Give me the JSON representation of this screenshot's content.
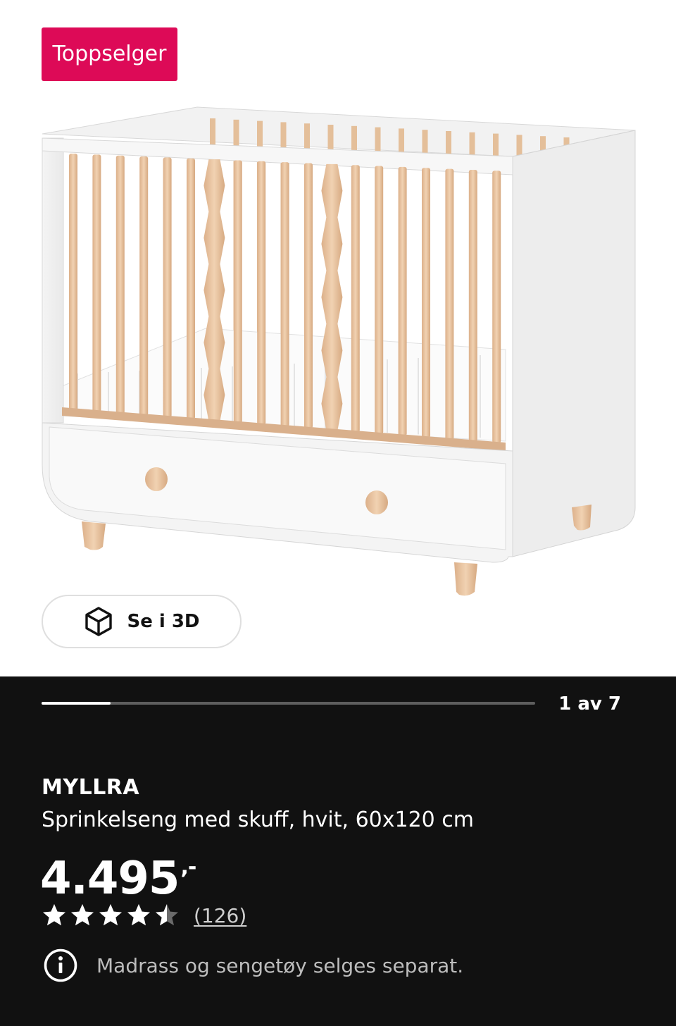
{
  "hero": {
    "badge": "Toppselger",
    "view_3d_label": "Se i 3D",
    "view_3d_icon": "cube-3d-icon",
    "image_subject": "crib"
  },
  "gallery": {
    "current": 1,
    "total": 7,
    "progress": 0.14,
    "pager_text": "1 av 7"
  },
  "product": {
    "name": "MYLLRA",
    "description": "Sprinkelseng med skuff, hvit, 60x120 cm",
    "price_main": "4.495",
    "price_suffix": ",-",
    "rating": 4.5,
    "rating_max": 5,
    "review_count": "(126)",
    "notice": "Madrass og sengetøy selges separat.",
    "notice_icon": "info-icon"
  },
  "colors": {
    "badge_bg": "#dd0a57",
    "panel_bg": "#111111",
    "wood": "#e8c4a0"
  }
}
